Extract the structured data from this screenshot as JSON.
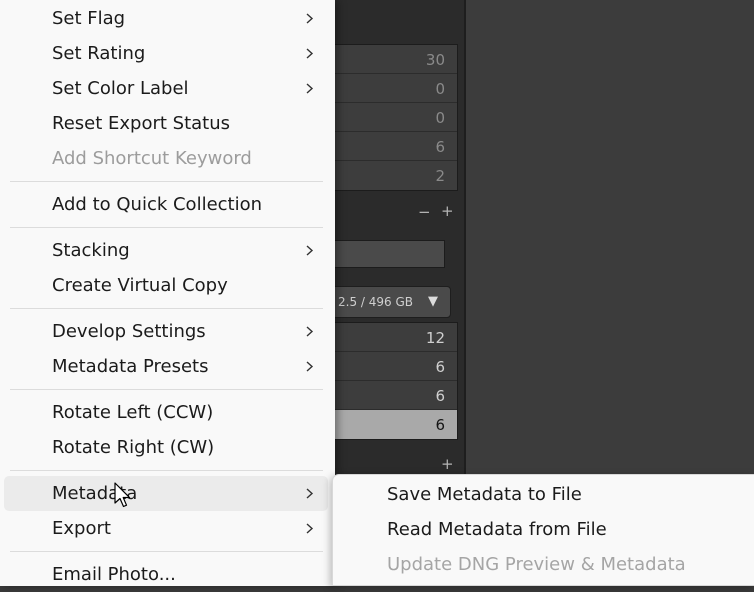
{
  "background": {
    "top_counts": [
      "30",
      "0",
      "0",
      "6",
      "2"
    ],
    "volume_label": "2.5 / 496 GB",
    "volume_dropdown_glyph": "▼",
    "minus_glyph": "−",
    "plus_glyph": "+",
    "folder_counts": [
      "12",
      "6",
      "6",
      "6"
    ]
  },
  "menu": {
    "items": [
      {
        "label": "Set Flag",
        "submenu": true,
        "disabled": false
      },
      {
        "label": "Set Rating",
        "submenu": true,
        "disabled": false
      },
      {
        "label": "Set Color Label",
        "submenu": true,
        "disabled": false
      },
      {
        "label": "Reset Export Status",
        "submenu": false,
        "disabled": false
      },
      {
        "label": "Add Shortcut Keyword",
        "submenu": false,
        "disabled": true
      },
      {
        "label": "Add to Quick Collection",
        "submenu": false,
        "disabled": false
      },
      {
        "label": "Stacking",
        "submenu": true,
        "disabled": false
      },
      {
        "label": "Create Virtual Copy",
        "submenu": false,
        "disabled": false
      },
      {
        "label": "Develop Settings",
        "submenu": true,
        "disabled": false
      },
      {
        "label": "Metadata Presets",
        "submenu": true,
        "disabled": false
      },
      {
        "label": "Rotate Left (CCW)",
        "submenu": false,
        "disabled": false
      },
      {
        "label": "Rotate Right (CW)",
        "submenu": false,
        "disabled": false
      },
      {
        "label": "Metadata",
        "submenu": true,
        "disabled": false,
        "highlighted": true
      },
      {
        "label": "Export",
        "submenu": true,
        "disabled": false
      },
      {
        "label": "Email Photo...",
        "submenu": false,
        "disabled": false
      }
    ]
  },
  "submenu": {
    "items": [
      {
        "label": "Save Metadata to File",
        "disabled": false
      },
      {
        "label": "Read Metadata from File",
        "disabled": false
      },
      {
        "label": "Update DNG Preview & Metadata",
        "disabled": true
      }
    ]
  }
}
